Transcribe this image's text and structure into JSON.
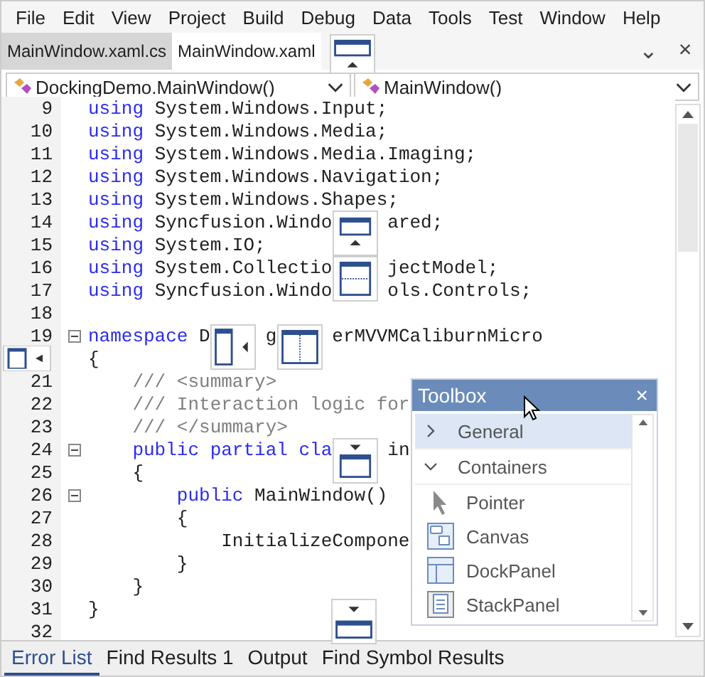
{
  "menu": [
    "File",
    "Edit",
    "View",
    "Project",
    "Build",
    "Debug",
    "Data",
    "Tools",
    "Test",
    "Window",
    "Help"
  ],
  "tabs": [
    {
      "label": "MainWindow.xaml.cs",
      "selected": false
    },
    {
      "label": "MainWindow.xaml",
      "selected": true
    }
  ],
  "tab_buttons": [
    "⌄",
    "×"
  ],
  "nav": [
    {
      "value": "DockingDemo.MainWindow()"
    },
    {
      "value": "MainWindow()"
    }
  ],
  "code": [
    {
      "number": "9",
      "fold": false,
      "tokens": [
        {
          "kind": "kw",
          "text": "using"
        },
        {
          "kind": "plain",
          "text": " System.Windows.Input;"
        }
      ]
    },
    {
      "number": "10",
      "fold": false,
      "tokens": [
        {
          "kind": "kw",
          "text": "using"
        },
        {
          "kind": "plain",
          "text": " System.Windows.Media;"
        }
      ]
    },
    {
      "number": "11",
      "fold": false,
      "tokens": [
        {
          "kind": "kw",
          "text": "using"
        },
        {
          "kind": "plain",
          "text": " System.Windows.Media.Imaging;"
        }
      ]
    },
    {
      "number": "12",
      "fold": false,
      "tokens": [
        {
          "kind": "kw",
          "text": "using"
        },
        {
          "kind": "plain",
          "text": " System.Windows.Navigation;"
        }
      ]
    },
    {
      "number": "13",
      "fold": false,
      "tokens": [
        {
          "kind": "kw",
          "text": "using"
        },
        {
          "kind": "plain",
          "text": " System.Windows.Shapes;"
        }
      ]
    },
    {
      "number": "14",
      "fold": false,
      "tokens": [
        {
          "kind": "kw",
          "text": "using"
        },
        {
          "kind": "plain",
          "text": " Syncfusion.Windo"
        },
        {
          "kind": "plain",
          "text": "ared;"
        }
      ]
    },
    {
      "number": "15",
      "fold": false,
      "tokens": [
        {
          "kind": "kw",
          "text": "using"
        },
        {
          "kind": "plain",
          "text": " System.IO;"
        }
      ]
    },
    {
      "number": "16",
      "fold": false,
      "tokens": [
        {
          "kind": "kw",
          "text": "using"
        },
        {
          "kind": "plain",
          "text": " System.Collectio"
        },
        {
          "kind": "plain",
          "text": "jectModel;"
        }
      ]
    },
    {
      "number": "17",
      "fold": false,
      "tokens": [
        {
          "kind": "kw",
          "text": "using"
        },
        {
          "kind": "plain",
          "text": " Syncfusion.Windo"
        },
        {
          "kind": "plain",
          "text": "ols.Controls;"
        }
      ]
    },
    {
      "number": "18",
      "fold": false
    },
    {
      "number": "19",
      "fold": true,
      "tokens": [
        {
          "kind": "kw",
          "text": "namespace"
        },
        {
          "kind": "plain",
          "text": " D"
        },
        {
          "kind": "plain",
          "text": "g"
        },
        {
          "kind": "plain",
          "text": "erMVVMCaliburnMicro"
        }
      ]
    },
    {
      "fold": false,
      "tokens": [
        {
          "kind": "plain",
          "text": "{"
        }
      ]
    },
    {
      "number": "21",
      "fold": false,
      "tokens": [
        {
          "kind": "comment",
          "text": "    /// <summary>"
        }
      ]
    },
    {
      "number": "22",
      "fold": false,
      "tokens": [
        {
          "kind": "comment",
          "text": "    /// Interaction logic for"
        }
      ]
    },
    {
      "number": "23",
      "fold": false,
      "tokens": [
        {
          "kind": "comment",
          "text": "    /// </summary>"
        }
      ]
    },
    {
      "number": "24",
      "fold": true,
      "tokens": [
        {
          "kind": "kw",
          "text": "    public partial cla"
        },
        {
          "kind": "plain",
          "text": "in"
        }
      ]
    },
    {
      "number": "25",
      "fold": false,
      "tokens": [
        {
          "kind": "plain",
          "text": "    {"
        }
      ]
    },
    {
      "number": "26",
      "fold": true,
      "tokens": [
        {
          "kind": "kw",
          "text": "        public"
        },
        {
          "kind": "plain",
          "text": " MainWindow()"
        }
      ]
    },
    {
      "number": "27",
      "fold": false,
      "tokens": [
        {
          "kind": "plain",
          "text": "        {"
        }
      ]
    },
    {
      "number": "28",
      "fold": false,
      "tokens": [
        {
          "kind": "plain",
          "text": "            InitializeCompone"
        }
      ]
    },
    {
      "number": "29",
      "fold": false,
      "tokens": [
        {
          "kind": "plain",
          "text": "        }"
        }
      ]
    },
    {
      "number": "30",
      "fold": false,
      "tokens": [
        {
          "kind": "plain",
          "text": "    }"
        }
      ]
    },
    {
      "number": "31",
      "fold": false,
      "tokens": [
        {
          "kind": "plain",
          "text": "}"
        }
      ]
    },
    {
      "number": "32",
      "fold": false
    }
  ],
  "toolbox": {
    "title": "Toolbox",
    "close": "×",
    "groups": [
      {
        "label": "General",
        "expanded": false,
        "selected": true
      },
      {
        "label": "Containers",
        "expanded": true,
        "selected": false,
        "children": [
          {
            "label": "Pointer"
          },
          {
            "label": "Canvas"
          },
          {
            "label": "DockPanel"
          },
          {
            "label": "StackPanel"
          }
        ]
      }
    ]
  },
  "bottom_tabs": [
    {
      "label": "Error List",
      "selected": true
    },
    {
      "label": "Find Results 1",
      "selected": false
    },
    {
      "label": "Output",
      "selected": false
    },
    {
      "label": "Find Symbol Results",
      "selected": false
    }
  ]
}
